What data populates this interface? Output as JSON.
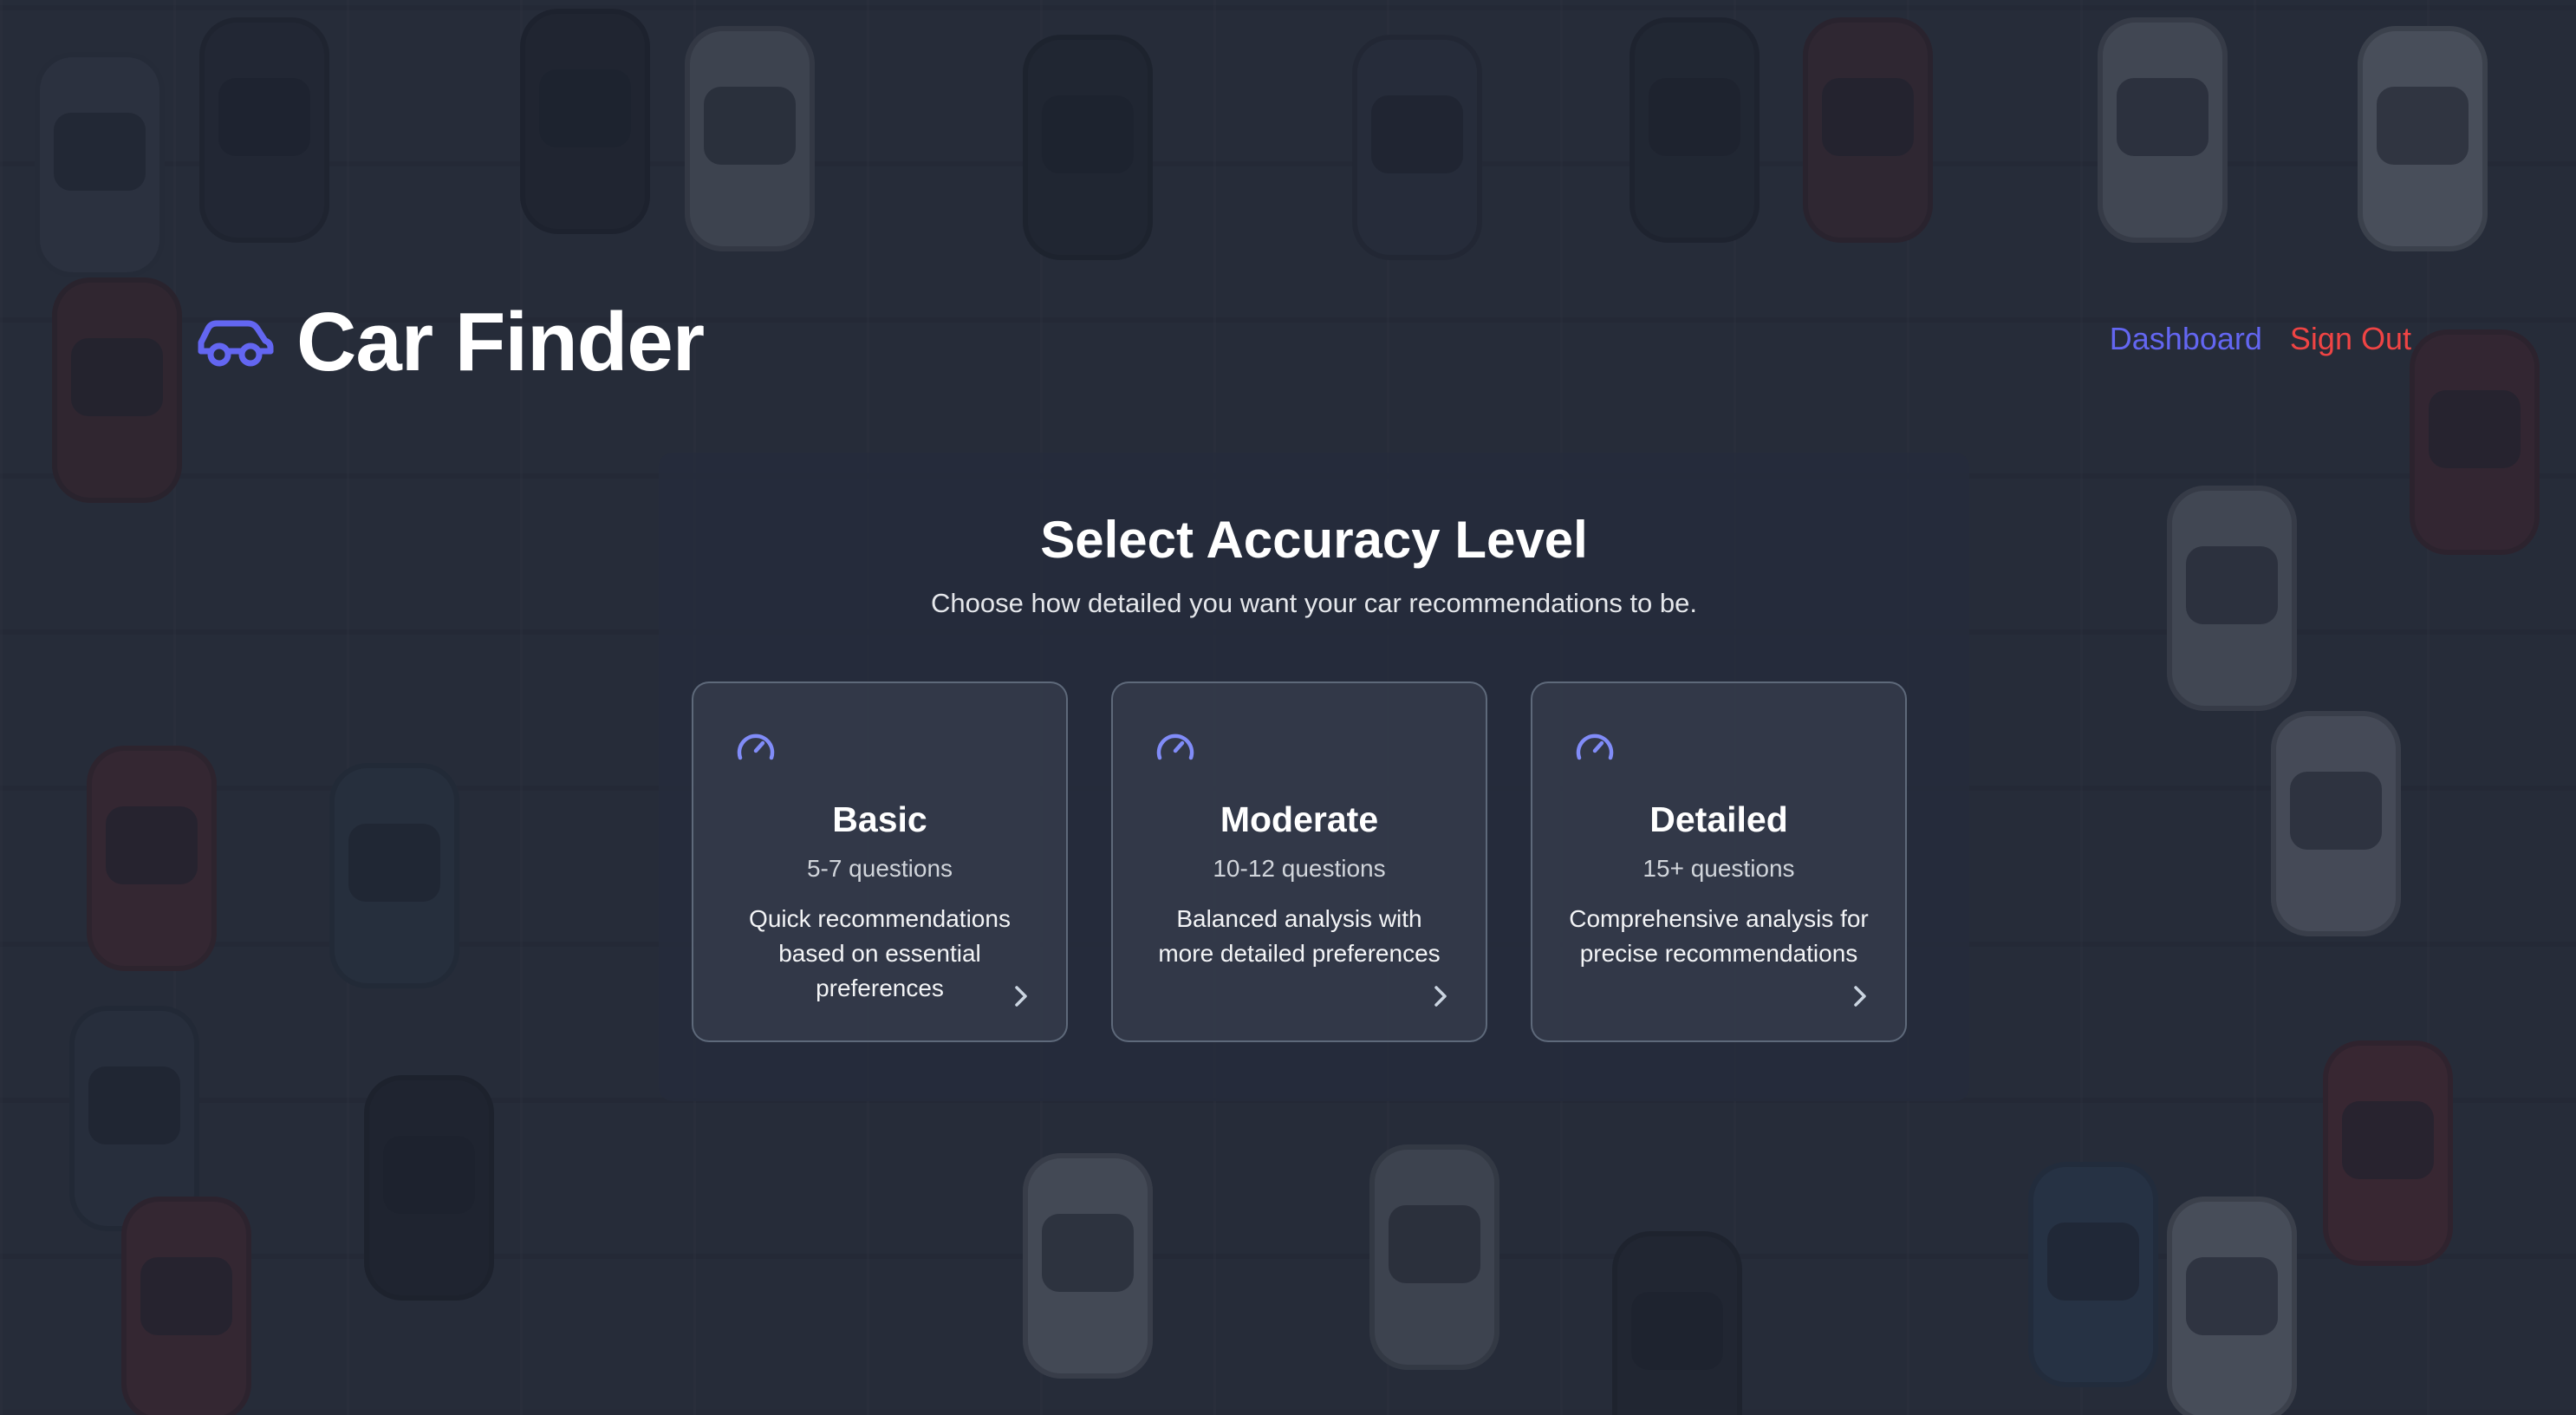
{
  "app": {
    "brand": "Car Finder",
    "logo_icon": "car-icon",
    "accent_color": "#6366f1",
    "danger_color": "#ef4444"
  },
  "nav": {
    "dashboard_label": "Dashboard",
    "signout_label": "Sign Out"
  },
  "main": {
    "title": "Select Accuracy Level",
    "subtitle": "Choose how detailed you want your car recommendations to be.",
    "cards": [
      {
        "icon": "gauge-icon",
        "title": "Basic",
        "questions": "5-7 questions",
        "description": "Quick recommendations based on essential preferences"
      },
      {
        "icon": "gauge-icon",
        "title": "Moderate",
        "questions": "10-12 questions",
        "description": "Balanced analysis with more detailed preferences"
      },
      {
        "icon": "gauge-icon",
        "title": "Detailed",
        "questions": "15+ questions",
        "description": "Comprehensive analysis for precise recommendations"
      }
    ]
  }
}
